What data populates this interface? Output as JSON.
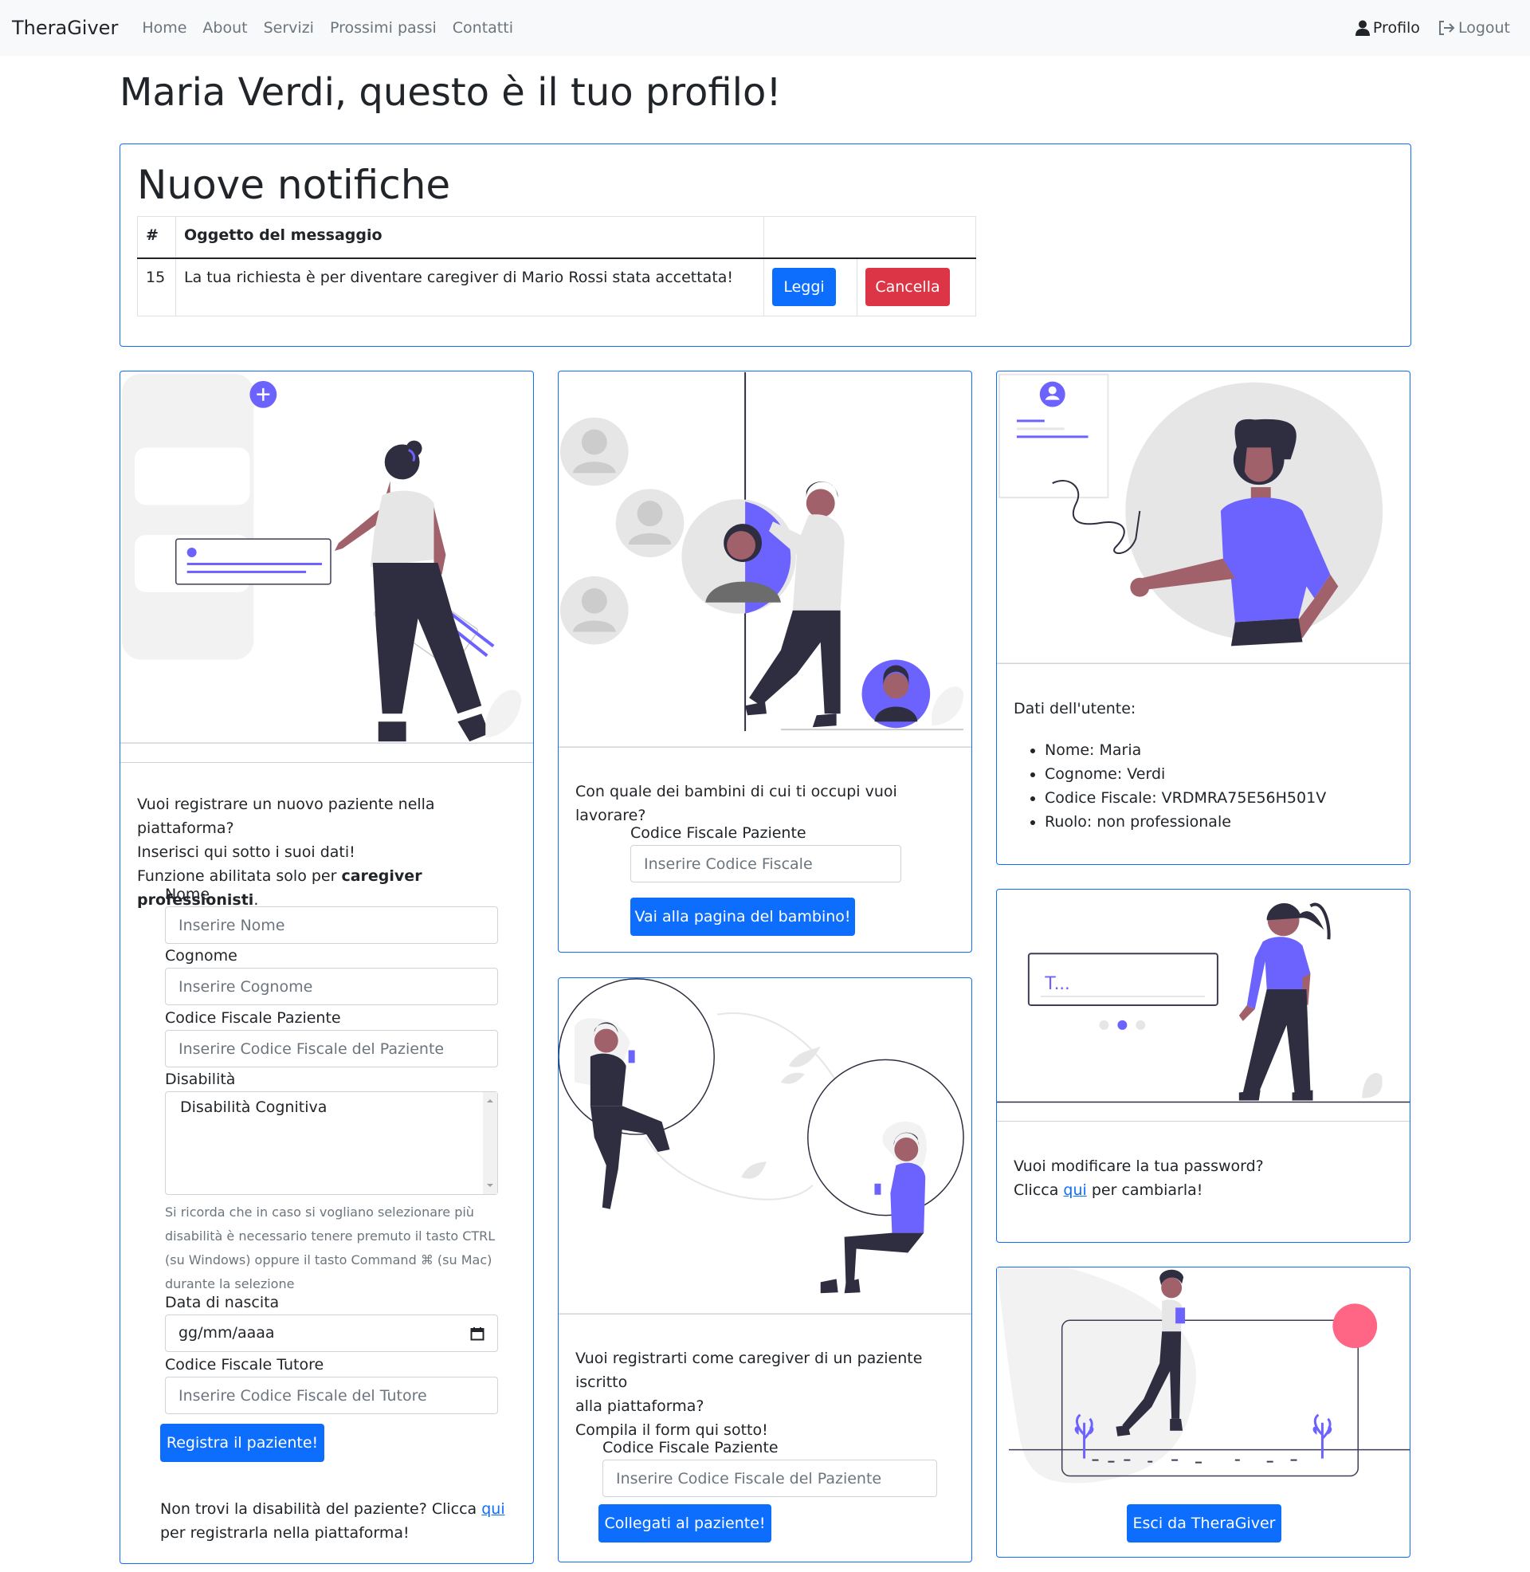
{
  "nav": {
    "brand": "TheraGiver",
    "links": [
      "Home",
      "About",
      "Servizi",
      "Prossimi passi",
      "Contatti"
    ],
    "profile": "Profilo",
    "logout": "Logout"
  },
  "page_title": "Maria Verdi, questo è il tuo profilo!",
  "notifications": {
    "title": "Nuove notifiche",
    "col_num": "#",
    "col_subject": "Oggetto del messaggio",
    "rows": [
      {
        "id": "15",
        "subject": "La tua richiesta è per diventare caregiver di Mario Rossi stata accettata!",
        "read_label": "Leggi",
        "delete_label": "Cancella"
      }
    ]
  },
  "register_patient": {
    "intro_line1": "Vuoi registrare un nuovo paziente nella piattaforma?",
    "intro_line2": "Inserisci qui sotto i suoi dati!",
    "intro_line3_prefix": "Funzione abilitata solo per ",
    "intro_line3_bold": "caregiver professionisti",
    "intro_line3_suffix": ".",
    "name_label": "Nome",
    "name_placeholder": "Inserire Nome",
    "surname_label": "Cognome",
    "surname_placeholder": "Inserire Cognome",
    "cf_label": "Codice Fiscale Paziente",
    "cf_placeholder": "Inserire Codice Fiscale del Paziente",
    "disability_label": "Disabilità",
    "disability_option": "Disabilità Cognitiva",
    "help_line1": "Si ricorda che in caso si vogliano selezionare più",
    "help_line2": "disabilità è necessario tenere premuto il tasto CTRL",
    "help_line3": "(su Windows) oppure il tasto Command ⌘ (su Mac)",
    "help_line4": "durante la selezione",
    "birth_label": "Data di nascita",
    "birth_value": "gg/mm/aaaa",
    "tutor_label": "Codice Fiscale Tutore",
    "tutor_placeholder": "Inserire Codice Fiscale del Tutore",
    "submit": "Registra il paziente!",
    "footer_line1_prefix": "Non trovi la disabilità del paziente? Clicca ",
    "footer_link": "qui",
    "footer_line2": "per registrarla nella piattaforma!"
  },
  "child_select": {
    "question": "Con quale dei bambini di cui ti occupi vuoi lavorare?",
    "cf_label": "Codice Fiscale Paziente",
    "cf_placeholder": "Inserire Codice Fiscale",
    "submit": "Vai alla pagina del bambino!"
  },
  "caregiver_register": {
    "line1": "Vuoi registrarti come caregiver di un paziente iscritto",
    "line2": "alla piattaforma?",
    "line3": "Compila il form qui sotto!",
    "cf_label": "Codice Fiscale Paziente",
    "cf_placeholder": "Inserire Codice Fiscale del Paziente",
    "submit": "Collegati al paziente!"
  },
  "user_data": {
    "title": "Dati dell'utente:",
    "items": [
      "Nome: Maria",
      "Cognome: Verdi",
      "Codice Fiscale: VRDMRA75E56H501V",
      "Ruolo: non professionale"
    ]
  },
  "password": {
    "line1": "Vuoi modificare la tua password?",
    "line2_prefix": "Clicca ",
    "link": "qui",
    "line2_suffix": " per cambiarla!",
    "field_text": "T..."
  },
  "exit": {
    "button": "Esci da TheraGiver"
  },
  "colors": {
    "primary": "#0d6efd",
    "danger": "#dc3545",
    "accent": "#6c63ff",
    "dark": "#2f2e41",
    "skin": "#a0616a"
  }
}
